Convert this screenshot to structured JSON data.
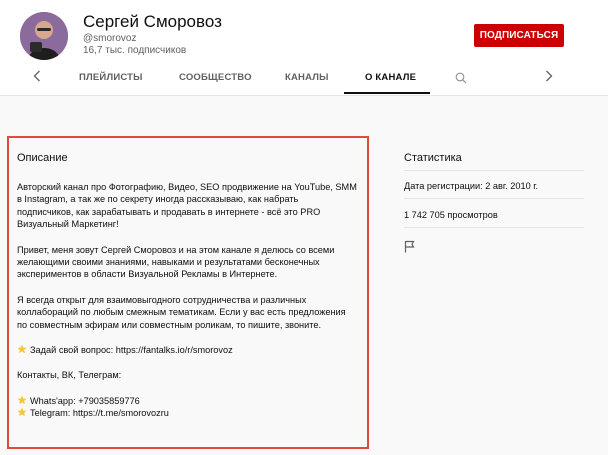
{
  "channel": {
    "name": "Сергей Сморовоз",
    "handle": "@smorovoz",
    "subscribers": "16,7 тыс. подписчиков",
    "subscribe_label": "ПОДПИСАТЬСЯ"
  },
  "tabs": [
    {
      "label": "ПЛЕЙЛИСТЫ",
      "active": false
    },
    {
      "label": "СООБЩЕСТВО",
      "active": false
    },
    {
      "label": "КАНАЛЫ",
      "active": false
    },
    {
      "label": "О КАНАЛЕ",
      "active": true
    }
  ],
  "about": {
    "title": "Описание",
    "paragraphs": [
      "Авторский канал про Фотографию, Видео, SEO продвижение на YouTube, SMM в Instagram, а так же по секрету иногда рассказываю, как набрать подписчиков, как зарабатывать и продавать в интернете - всё это PRO Визуальный Маркетинг!",
      "Привет, меня зовут Сергей Сморовоз и на этом канале я делюсь со всеми желающими своими знаниями, навыками и результатами бесконечных экспериментов в области Визуальной Рекламы в Интернете.",
      "Я всегда открыт для взаимовыгодного сотрудничества и различных коллабораций по любым смежным тематикам. Если у вас есть предложения по совместным эфирам или совместным роликам, то пишите, звоните."
    ],
    "ask_question": "Задай свой вопрос: https://fantalks.io/r/smorovoz",
    "contacts_heading": "Контакты, ВК, Телеграм:",
    "whatsapp": "Whats'app: +79035859776",
    "telegram": "Telegram: https://t.me/smorovozru"
  },
  "stats": {
    "title": "Статистика",
    "registration": "Дата регистрации: 2 авг. 2010 г.",
    "views": "1 742 705 просмотров"
  },
  "colors": {
    "subscribe": "#cc0000",
    "highlight_border": "#e24a3b",
    "star": "#f9c531"
  },
  "icons": {
    "prev": "chevron-left-icon",
    "next": "chevron-right-icon",
    "search": "search-icon",
    "report": "flag-icon",
    "bullet": "star-icon"
  }
}
